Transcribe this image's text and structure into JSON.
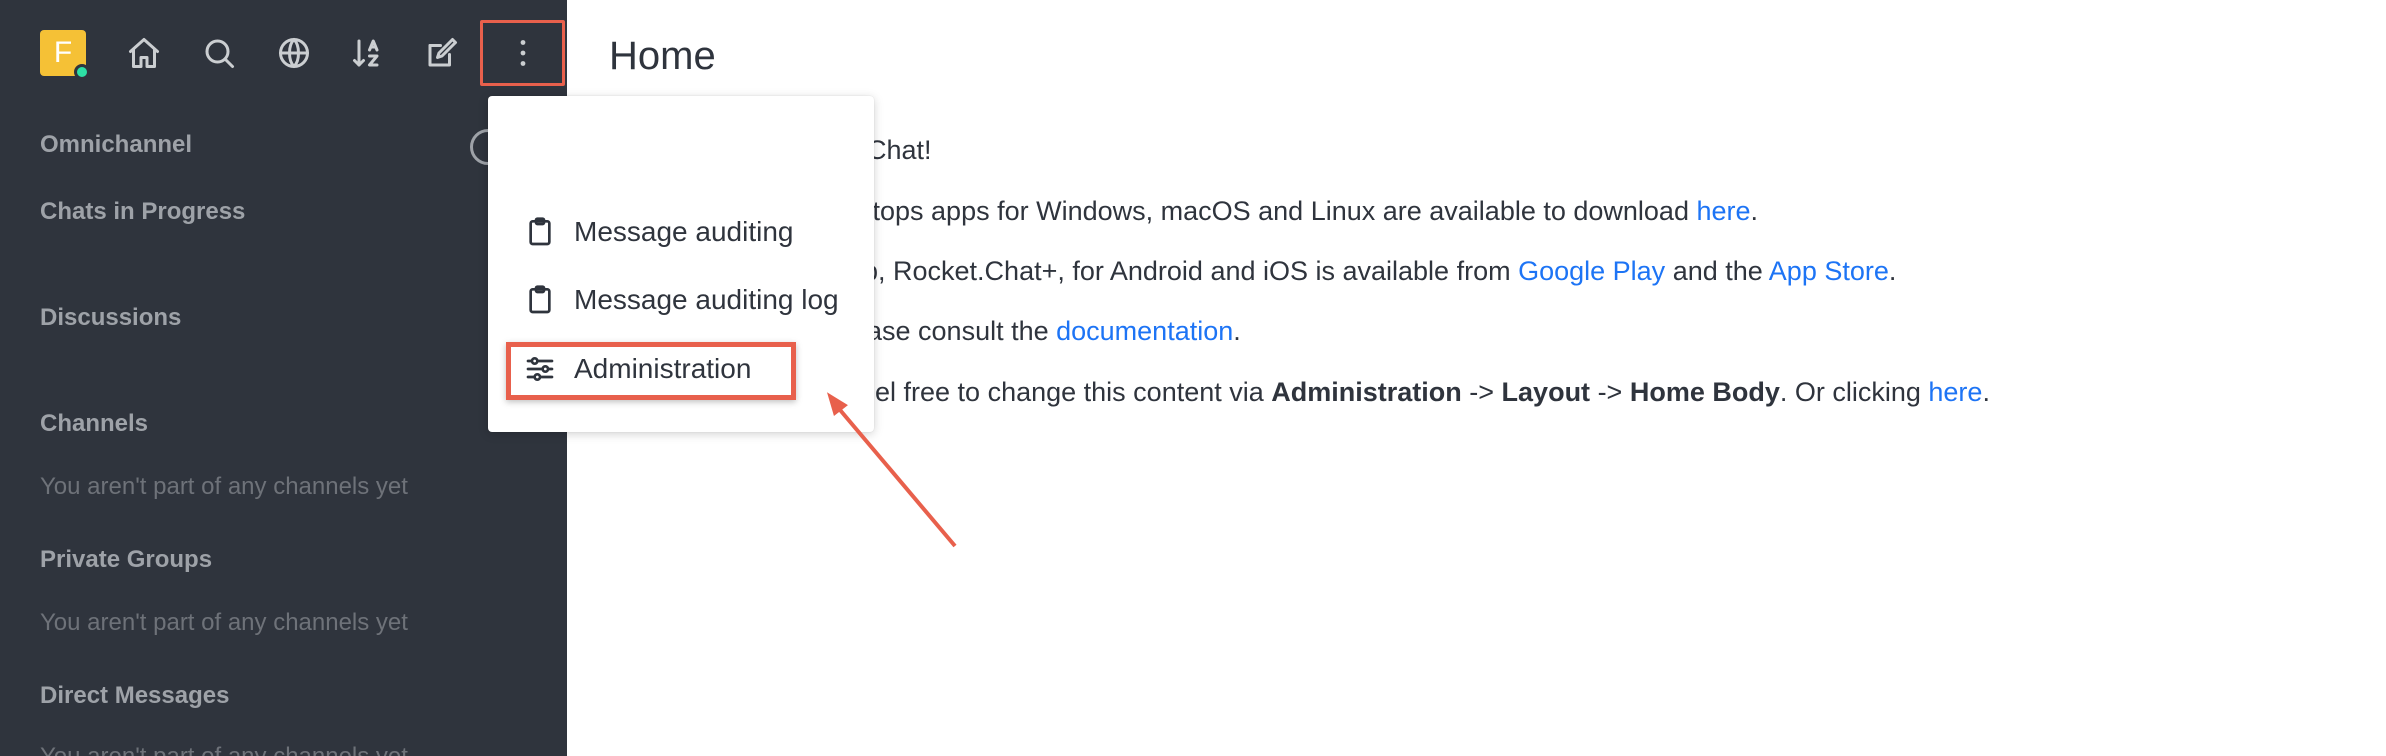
{
  "user": {
    "initial": "F"
  },
  "sidebar": {
    "sections": [
      {
        "label": "Omnichannel"
      },
      {
        "label": "Chats in Progress"
      },
      {
        "label": "Discussions"
      },
      {
        "label": "Channels"
      },
      {
        "label": "Private Groups"
      },
      {
        "label": "Direct Messages"
      }
    ],
    "empty_text": "You aren't part of any channels yet"
  },
  "main": {
    "title": "Home",
    "lines": [
      {
        "text": "Chat!"
      },
      {
        "pre": "ktops apps for Windows, macOS and Linux are available to download ",
        "link": "here",
        "post": "."
      },
      {
        "pre": "p, Rocket.Chat+, for Android and iOS is available from ",
        "link1": "Google Play",
        "mid": " and the ",
        "link2": "App Store",
        "post": "."
      },
      {
        "pre": "ase consult the ",
        "link": "documentation",
        "post": "."
      },
      {
        "pre": "eel free to change this content via ",
        "b1": "Administration",
        "arrow1": " -> ",
        "b2": "Layout",
        "arrow2": " -> ",
        "b3": "Home Body",
        "mid": ". Or clicking ",
        "link": "here",
        "post": "."
      }
    ]
  },
  "menu": {
    "items": [
      {
        "label": "Message auditing",
        "icon": "clipboard-icon"
      },
      {
        "label": "Message auditing log",
        "icon": "clipboard-icon"
      },
      {
        "label": "Administration",
        "icon": "sliders-icon"
      }
    ]
  },
  "colors": {
    "sidebar_bg": "#2f343d",
    "highlight": "#e8604c",
    "link": "#1d74f5",
    "avatar": "#f5c136",
    "status_online": "#2de0a5"
  }
}
